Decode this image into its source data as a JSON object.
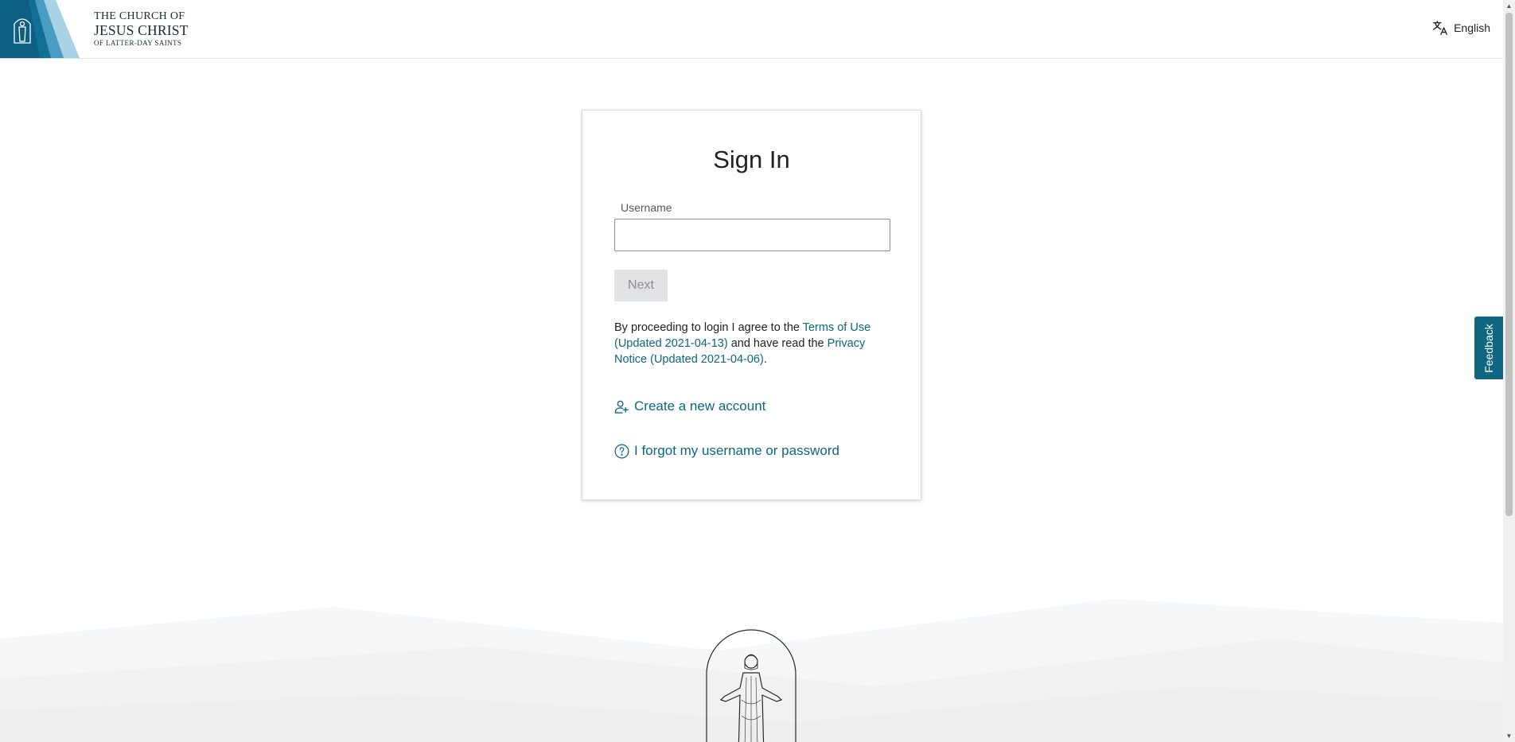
{
  "header": {
    "logo_line1": "THE CHURCH OF",
    "logo_line2": "JESUS CHRIST",
    "logo_line3": "OF LATTER-DAY SAINTS",
    "language": "English",
    "translate_icon": "translate-icon"
  },
  "signin": {
    "title": "Sign In",
    "username_label": "Username",
    "username_value": "",
    "next_label": "Next",
    "terms_prefix": "By proceeding to login I agree to the ",
    "terms_link": "Terms of Use (Updated 2021-04-13)",
    "terms_middle": " and have read the ",
    "privacy_link": "Privacy Notice (Updated 2021-04-06)",
    "terms_suffix": ".",
    "create_account": "Create a new account",
    "create_account_icon": "add-user-icon",
    "forgot": "I forgot my username or password",
    "forgot_icon": "question-circle-icon"
  },
  "feedback": {
    "label": "Feedback"
  },
  "colors": {
    "accent": "#0e6680",
    "button_disabled_bg": "#e1e3e5",
    "button_disabled_text": "#8a8d91"
  }
}
